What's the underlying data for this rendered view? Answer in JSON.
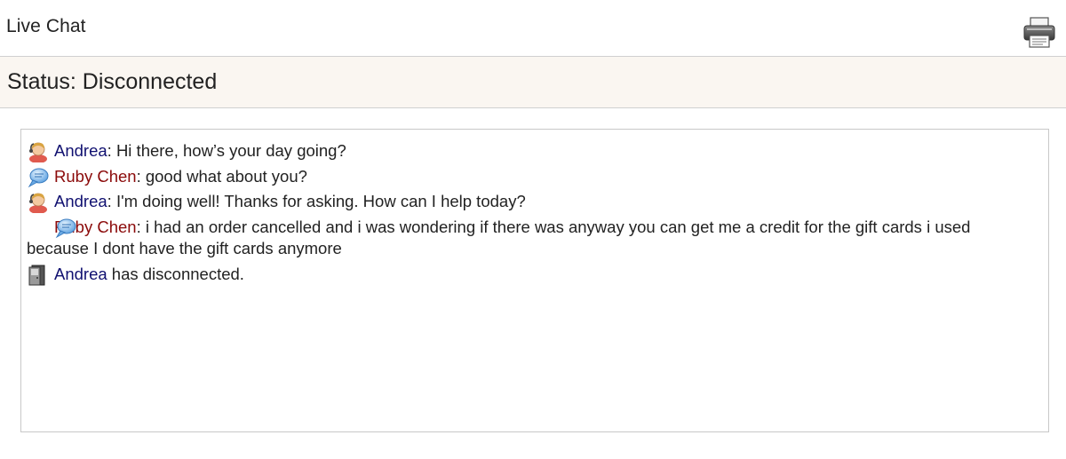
{
  "header": {
    "title": "Live Chat",
    "print_icon": "printer-icon"
  },
  "status": {
    "text": "Status: Disconnected"
  },
  "chat": {
    "messages": [
      {
        "author": "Andrea",
        "role": "agent",
        "icon": "agent-avatar-icon",
        "separator": ": ",
        "text": "Hi there, how’s your day going?"
      },
      {
        "author": "Ruby Chen",
        "role": "customer",
        "icon": "chat-bubble-icon",
        "separator": ": ",
        "text": "good what about you?"
      },
      {
        "author": "Andrea",
        "role": "agent",
        "icon": "agent-avatar-icon",
        "separator": ": ",
        "text": "I'm doing well! Thanks for asking. How can I help today?"
      },
      {
        "author": "Ruby Chen",
        "role": "customer",
        "icon": "chat-bubble-icon",
        "separator": ": ",
        "text": "i had an order cancelled and i was wondering if there was anyway you can get me a credit for the gift cards i used because I dont have the gift cards anymore"
      },
      {
        "author": "Andrea",
        "role": "agent",
        "icon": "disconnect-door-icon",
        "separator": " ",
        "text": "has disconnected."
      }
    ]
  },
  "colors": {
    "agent_name": "#101070",
    "customer_name": "#8b0a0a",
    "status_bg": "#faf6f1",
    "border": "#d0d0d0"
  }
}
